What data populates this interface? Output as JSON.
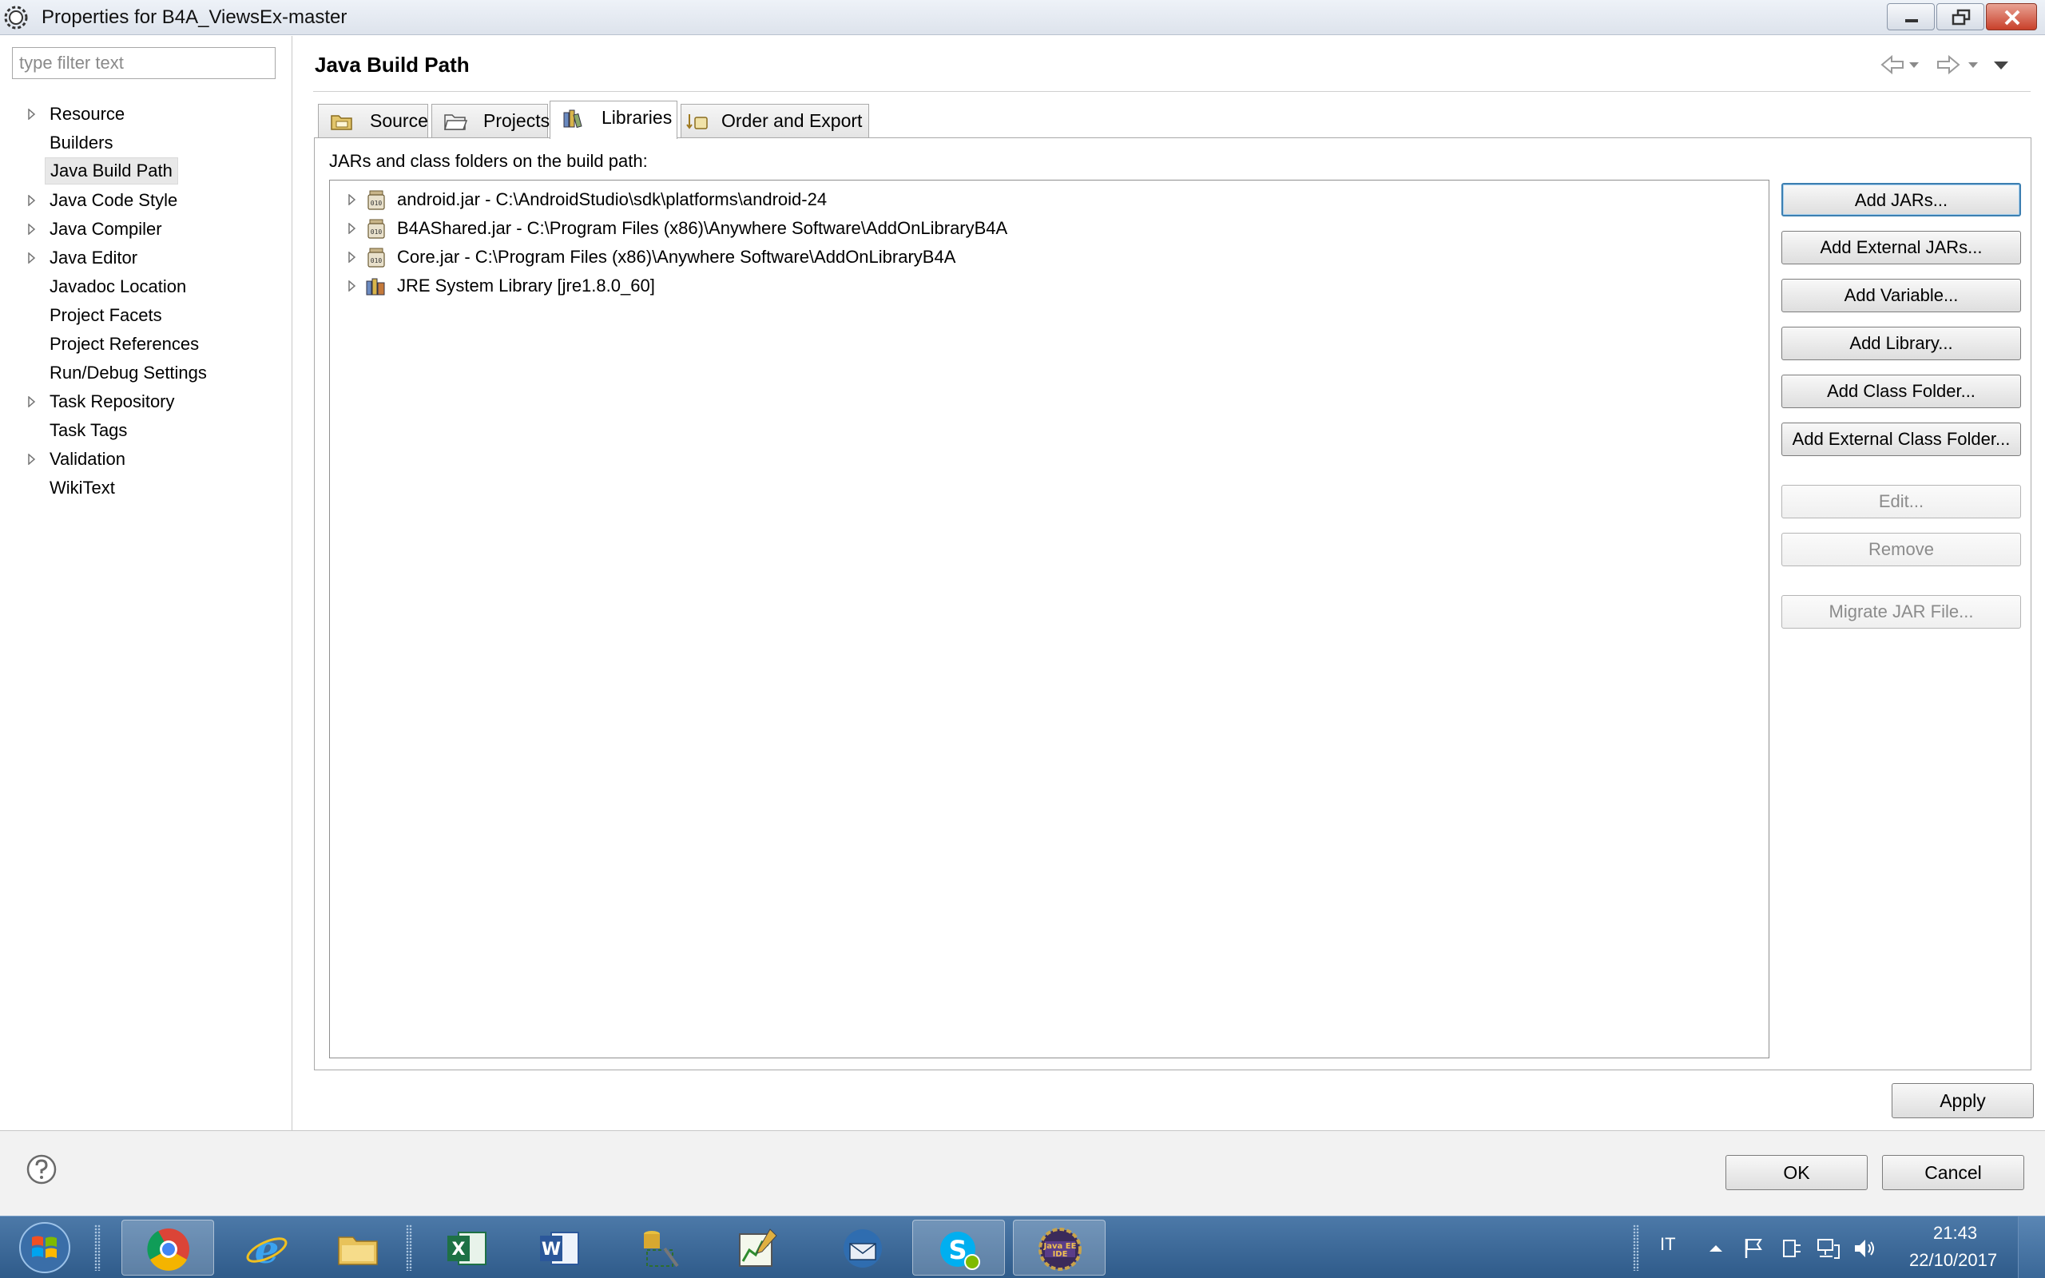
{
  "window": {
    "title": "Properties for B4A_ViewsEx-master"
  },
  "sidebar": {
    "filter_placeholder": "type filter text",
    "items": [
      {
        "label": "Resource",
        "expandable": true
      },
      {
        "label": "Builders",
        "expandable": false
      },
      {
        "label": "Java Build Path",
        "expandable": false,
        "selected": true
      },
      {
        "label": "Java Code Style",
        "expandable": true
      },
      {
        "label": "Java Compiler",
        "expandable": true
      },
      {
        "label": "Java Editor",
        "expandable": true
      },
      {
        "label": "Javadoc Location",
        "expandable": false
      },
      {
        "label": "Project Facets",
        "expandable": false
      },
      {
        "label": "Project References",
        "expandable": false
      },
      {
        "label": "Run/Debug Settings",
        "expandable": false
      },
      {
        "label": "Task Repository",
        "expandable": true
      },
      {
        "label": "Task Tags",
        "expandable": false
      },
      {
        "label": "Validation",
        "expandable": true
      },
      {
        "label": "WikiText",
        "expandable": false
      }
    ]
  },
  "page": {
    "title": "Java Build Path"
  },
  "tabs": [
    {
      "label": "Source",
      "icon": "source-folder-icon"
    },
    {
      "label": "Projects",
      "icon": "projects-folder-icon"
    },
    {
      "label": "Libraries",
      "icon": "libraries-icon",
      "active": true
    },
    {
      "label": "Order and Export",
      "icon": "order-export-icon"
    }
  ],
  "libraries": {
    "section_label": "JARs and class folders on the build path:",
    "items": [
      {
        "label": "android.jar - C:\\AndroidStudio\\sdk\\platforms\\android-24",
        "icon": "jar-icon"
      },
      {
        "label": "B4AShared.jar - C:\\Program Files (x86)\\Anywhere Software\\AddOnLibraryB4A",
        "icon": "jar-icon"
      },
      {
        "label": "Core.jar - C:\\Program Files (x86)\\Anywhere Software\\AddOnLibraryB4A",
        "icon": "jar-icon"
      },
      {
        "label": "JRE System Library [jre1.8.0_60]",
        "icon": "library-icon"
      }
    ]
  },
  "buttons": {
    "add_jars": "Add JARs...",
    "add_external_jars": "Add External JARs...",
    "add_variable": "Add Variable...",
    "add_library": "Add Library...",
    "add_class_folder": "Add Class Folder...",
    "add_external_class_folder": "Add External Class Folder...",
    "edit": "Edit...",
    "remove": "Remove",
    "migrate_jar": "Migrate JAR File...",
    "apply": "Apply",
    "ok": "OK",
    "cancel": "Cancel"
  },
  "taskbar": {
    "language": "IT",
    "time": "21:43",
    "date": "22/10/2017",
    "apps": [
      "chrome-icon",
      "internet-explorer-icon",
      "file-explorer-icon",
      "excel-icon",
      "word-icon",
      "database-tool-icon",
      "chart-editor-icon",
      "thunderbird-icon",
      "skype-icon",
      "eclipse-javaee-icon"
    ]
  },
  "colors": {
    "default_button_border": "#3c7fb1",
    "taskbar": "#2f5b8a"
  }
}
